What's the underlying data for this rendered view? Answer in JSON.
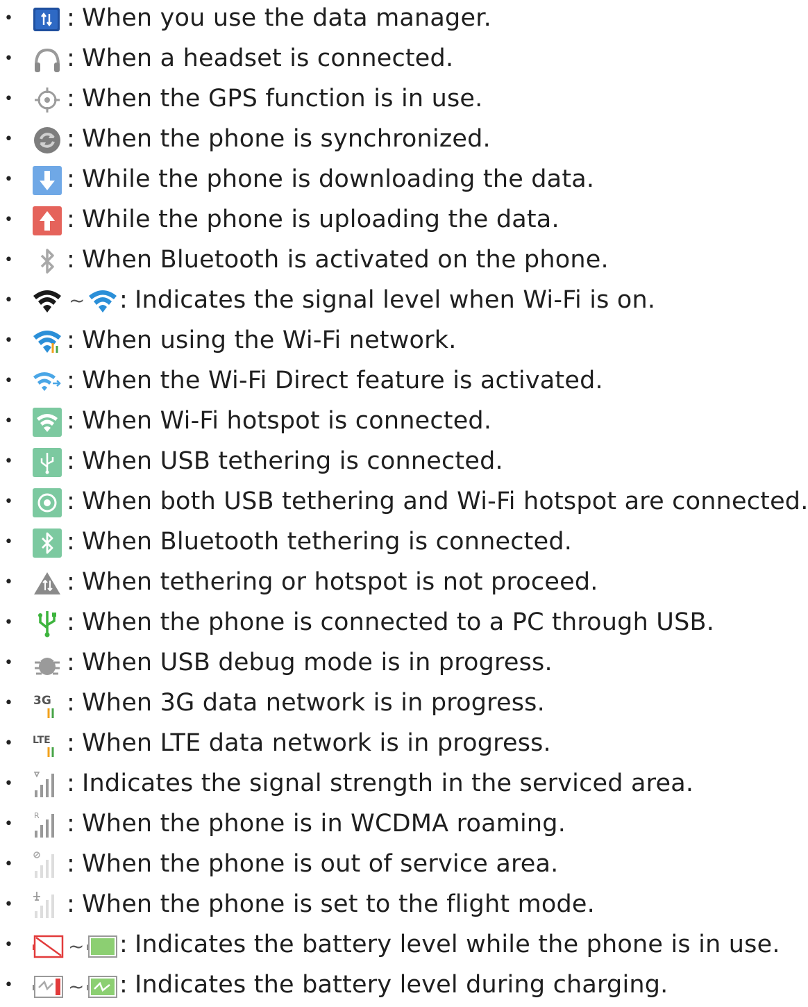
{
  "items": [
    {
      "icon": "data-manager-icon",
      "text": "When you use the data manager."
    },
    {
      "icon": "headset-icon",
      "text": "When a headset is connected."
    },
    {
      "icon": "gps-icon",
      "text": "When the GPS function is in use."
    },
    {
      "icon": "sync-icon",
      "text": "When the phone is synchronized."
    },
    {
      "icon": "download-icon",
      "text": "While the phone is downloading the data."
    },
    {
      "icon": "upload-icon",
      "text": "While the phone is uploading the data."
    },
    {
      "icon": "bluetooth-icon",
      "text": "When Bluetooth is activated on the phone."
    },
    {
      "icon": "wifi-signal-range-icon",
      "separator": "~",
      "text": "Indicates the signal level when Wi-Fi is on."
    },
    {
      "icon": "wifi-in-use-icon",
      "text": "When using the Wi-Fi network."
    },
    {
      "icon": "wifi-direct-icon",
      "text": "When the Wi-Fi Direct feature is activated."
    },
    {
      "icon": "wifi-hotspot-icon",
      "text": "When Wi-Fi hotspot is connected."
    },
    {
      "icon": "usb-tethering-icon",
      "text": "When USB tethering is connected."
    },
    {
      "icon": "usb-and-hotspot-icon",
      "text": "When both USB tethering and Wi-Fi hotspot are connected."
    },
    {
      "icon": "bluetooth-tethering-icon",
      "text": "When Bluetooth tethering is connected."
    },
    {
      "icon": "tethering-warning-icon",
      "text": "When tethering or hotspot is not proceed."
    },
    {
      "icon": "usb-connected-icon",
      "text": "When the phone is connected to a PC through USB."
    },
    {
      "icon": "usb-debug-icon",
      "text": "When USB debug mode is in progress."
    },
    {
      "icon": "3g-data-icon",
      "label": "3G",
      "text": "When 3G data network is in progress."
    },
    {
      "icon": "lte-data-icon",
      "label": "LTE",
      "text": "When LTE data network is in progress."
    },
    {
      "icon": "signal-strength-icon",
      "text": "Indicates the signal strength in the serviced area."
    },
    {
      "icon": "roaming-icon",
      "label": "R",
      "text": "When the phone is in WCDMA roaming."
    },
    {
      "icon": "no-service-icon",
      "text": "When the phone is out of service area."
    },
    {
      "icon": "flight-mode-icon",
      "text": "When the phone is set to the flight mode."
    },
    {
      "icon": "battery-level-range-icon",
      "separator": "~",
      "text": "Indicates the battery level while the phone is in use."
    },
    {
      "icon": "battery-charging-range-icon",
      "separator": "~",
      "text": "Indicates the battery level during charging."
    }
  ],
  "punctuation": {
    "bullet": "•",
    "colon": ":"
  },
  "colors": {
    "text": "#1f1f1f",
    "wifi_blue": "#2b8fd8",
    "tether_green": "#7cc9a0",
    "download_blue": "#6fa8e6",
    "upload_red": "#e5635b",
    "usb_green": "#3db43d",
    "battery_red": "#e23b3b"
  }
}
